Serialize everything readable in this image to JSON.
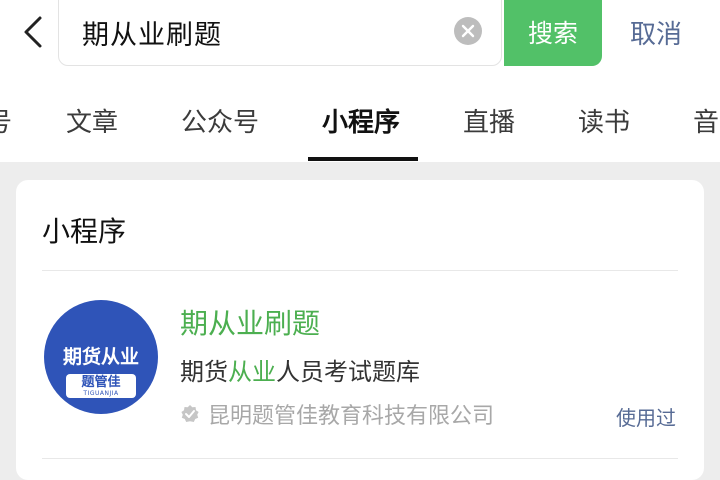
{
  "search": {
    "query": "期从业刷题",
    "button_label": "搜索",
    "cancel_label": "取消"
  },
  "tabs": [
    {
      "label": "号"
    },
    {
      "label": "文章"
    },
    {
      "label": "公众号"
    },
    {
      "label": "小程序",
      "active": true
    },
    {
      "label": "直播"
    },
    {
      "label": "读书"
    },
    {
      "label": "音"
    }
  ],
  "results": {
    "section_title": "小程序",
    "item": {
      "name": "期从业刷题",
      "desc_prefix": "期货",
      "desc_highlight": "从业",
      "desc_suffix": "人员考试题库",
      "company": "昆明题管佳教育科技有限公司",
      "used_label": "使用过",
      "logo": {
        "text": "期货从业",
        "badge_name": "题管佳",
        "badge_sub": "TIGUANJIA"
      }
    }
  },
  "colors": {
    "accent_green": "#52c168",
    "link_blue": "#576b95",
    "logo_blue": "#2f54b8"
  },
  "icons": [
    "back-arrow-icon",
    "clear-icon",
    "verified-icon"
  ]
}
